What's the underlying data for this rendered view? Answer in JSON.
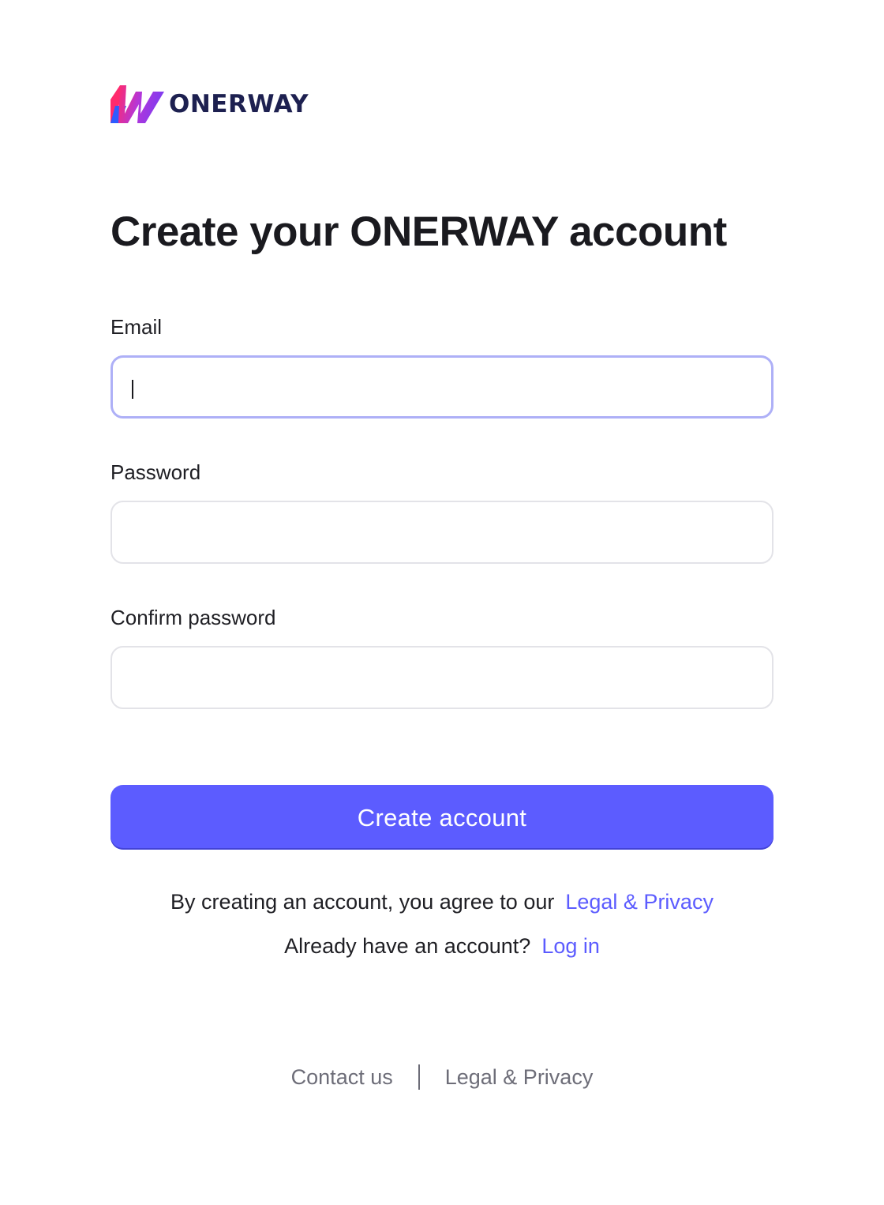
{
  "brand": {
    "name": "ONERWAY",
    "colors": {
      "navy": "#1d2050",
      "pink": "#ff2a6d",
      "purple": "#7f3cf0",
      "blue": "#2d5bff"
    }
  },
  "page": {
    "title": "Create your ONERWAY account"
  },
  "form": {
    "email": {
      "label": "Email",
      "value": "",
      "placeholder": "",
      "focused": true
    },
    "password": {
      "label": "Password",
      "value": "",
      "placeholder": ""
    },
    "confirm_password": {
      "label": "Confirm password",
      "value": "",
      "placeholder": ""
    },
    "submit_label": "Create account"
  },
  "agreement": {
    "text": "By creating an account, you agree to our",
    "link": "Legal & Privacy"
  },
  "login_prompt": {
    "text": "Already have an account?",
    "link": "Log in"
  },
  "footer": {
    "contact": "Contact us",
    "legal": "Legal & Privacy"
  },
  "colors": {
    "accent": "#5c5cff",
    "focus_border": "#aeb0f7",
    "input_border": "#e3e3e8",
    "muted_text": "#6d6d78"
  }
}
